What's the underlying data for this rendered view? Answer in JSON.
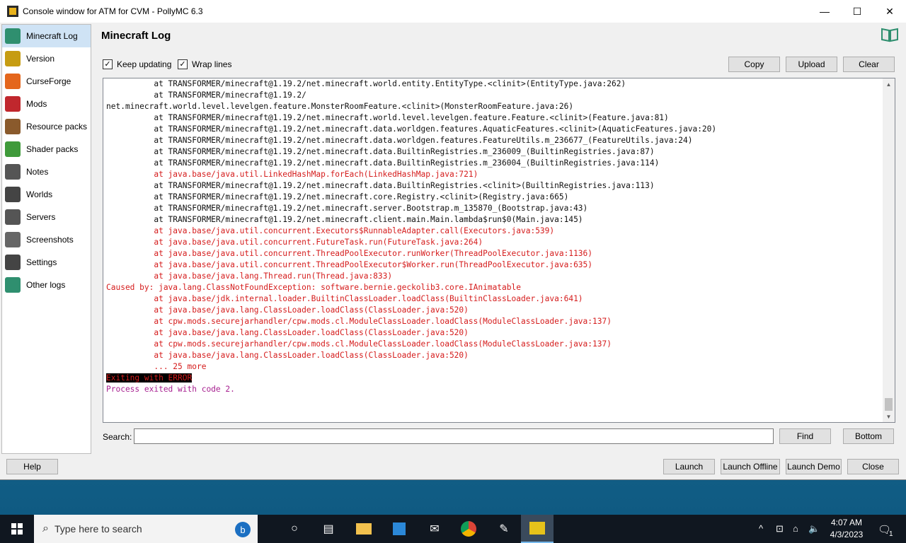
{
  "window": {
    "title": "Console window for ATM for CVM - PollyMC 6.3",
    "minimize": "—",
    "maximize": "☐",
    "close": "✕"
  },
  "sidebar": {
    "items": [
      {
        "label": "Minecraft Log",
        "icon": "book-icon",
        "color": "#2f8f6f",
        "active": true
      },
      {
        "label": "Version",
        "icon": "version-icon",
        "color": "#c69c12"
      },
      {
        "label": "CurseForge",
        "icon": "curseforge-icon",
        "color": "#e4661c"
      },
      {
        "label": "Mods",
        "icon": "mods-icon",
        "color": "#c0272d"
      },
      {
        "label": "Resource packs",
        "icon": "resource-pack-icon",
        "color": "#8a5a2c"
      },
      {
        "label": "Shader packs",
        "icon": "shader-pack-icon",
        "color": "#3f9a3a"
      },
      {
        "label": "Notes",
        "icon": "notes-icon",
        "color": "#555555"
      },
      {
        "label": "Worlds",
        "icon": "worlds-icon",
        "color": "#444444"
      },
      {
        "label": "Servers",
        "icon": "servers-icon",
        "color": "#555555"
      },
      {
        "label": "Screenshots",
        "icon": "screenshots-icon",
        "color": "#666666"
      },
      {
        "label": "Settings",
        "icon": "settings-icon",
        "color": "#444444"
      },
      {
        "label": "Other logs",
        "icon": "other-logs-icon",
        "color": "#2f8f6f"
      }
    ]
  },
  "main": {
    "title": "Minecraft Log",
    "keep_updating": "Keep updating",
    "wrap_lines": "Wrap lines",
    "copy": "Copy",
    "upload": "Upload",
    "clear": "Clear",
    "search_label": "Search:",
    "search_value": "",
    "find": "Find",
    "bottom": "Bottom"
  },
  "log": {
    "lines": [
      {
        "text": "          at TRANSFORMER/minecraft@1.19.2/net.minecraft.world.entity.EntityType.<clinit>(EntityType.java:262)",
        "kind": "normal"
      },
      {
        "text": "          at TRANSFORMER/minecraft@1.19.2/",
        "kind": "normal"
      },
      {
        "text": "net.minecraft.world.level.levelgen.feature.MonsterRoomFeature.<clinit>(MonsterRoomFeature.java:26)",
        "kind": "normal"
      },
      {
        "text": "          at TRANSFORMER/minecraft@1.19.2/net.minecraft.world.level.levelgen.feature.Feature.<clinit>(Feature.java:81)",
        "kind": "normal"
      },
      {
        "text": "          at TRANSFORMER/minecraft@1.19.2/net.minecraft.data.worldgen.features.AquaticFeatures.<clinit>(AquaticFeatures.java:20)",
        "kind": "normal"
      },
      {
        "text": "          at TRANSFORMER/minecraft@1.19.2/net.minecraft.data.worldgen.features.FeatureUtils.m_236677_(FeatureUtils.java:24)",
        "kind": "normal"
      },
      {
        "text": "          at TRANSFORMER/minecraft@1.19.2/net.minecraft.data.BuiltinRegistries.m_236009_(BuiltinRegistries.java:87)",
        "kind": "normal"
      },
      {
        "text": "          at TRANSFORMER/minecraft@1.19.2/net.minecraft.data.BuiltinRegistries.m_236004_(BuiltinRegistries.java:114)",
        "kind": "normal"
      },
      {
        "text": "          at java.base/java.util.LinkedHashMap.forEach(LinkedHashMap.java:721)",
        "kind": "err"
      },
      {
        "text": "          at TRANSFORMER/minecraft@1.19.2/net.minecraft.data.BuiltinRegistries.<clinit>(BuiltinRegistries.java:113)",
        "kind": "normal"
      },
      {
        "text": "          at TRANSFORMER/minecraft@1.19.2/net.minecraft.core.Registry.<clinit>(Registry.java:665)",
        "kind": "normal"
      },
      {
        "text": "          at TRANSFORMER/minecraft@1.19.2/net.minecraft.server.Bootstrap.m_135870_(Bootstrap.java:43)",
        "kind": "normal"
      },
      {
        "text": "          at TRANSFORMER/minecraft@1.19.2/net.minecraft.client.main.Main.lambda$run$0(Main.java:145)",
        "kind": "normal"
      },
      {
        "text": "          at java.base/java.util.concurrent.Executors$RunnableAdapter.call(Executors.java:539)",
        "kind": "err"
      },
      {
        "text": "          at java.base/java.util.concurrent.FutureTask.run(FutureTask.java:264)",
        "kind": "err"
      },
      {
        "text": "          at java.base/java.util.concurrent.ThreadPoolExecutor.runWorker(ThreadPoolExecutor.java:1136)",
        "kind": "err"
      },
      {
        "text": "          at java.base/java.util.concurrent.ThreadPoolExecutor$Worker.run(ThreadPoolExecutor.java:635)",
        "kind": "err"
      },
      {
        "text": "          at java.base/java.lang.Thread.run(Thread.java:833)",
        "kind": "err"
      },
      {
        "text": "Caused by: java.lang.ClassNotFoundException: software.bernie.geckolib3.core.IAnimatable",
        "kind": "err"
      },
      {
        "text": "          at java.base/jdk.internal.loader.BuiltinClassLoader.loadClass(BuiltinClassLoader.java:641)",
        "kind": "err"
      },
      {
        "text": "          at java.base/java.lang.ClassLoader.loadClass(ClassLoader.java:520)",
        "kind": "err"
      },
      {
        "text": "          at cpw.mods.securejarhandler/cpw.mods.cl.ModuleClassLoader.loadClass(ModuleClassLoader.java:137)",
        "kind": "err"
      },
      {
        "text": "          at java.base/java.lang.ClassLoader.loadClass(ClassLoader.java:520)",
        "kind": "err"
      },
      {
        "text": "          at cpw.mods.securejarhandler/cpw.mods.cl.ModuleClassLoader.loadClass(ModuleClassLoader.java:137)",
        "kind": "err"
      },
      {
        "text": "          at java.base/java.lang.ClassLoader.loadClass(ClassLoader.java:520)",
        "kind": "err"
      },
      {
        "text": "          ... 25 more",
        "kind": "err"
      },
      {
        "text": "Exiting with ERROR",
        "kind": "errbox"
      },
      {
        "text": "Process exited with code 2.",
        "kind": "exit"
      }
    ]
  },
  "footer": {
    "help": "Help",
    "launch": "Launch",
    "launch_offline": "Launch Offline",
    "launch_demo": "Launch Demo",
    "close": "Close"
  },
  "taskbar": {
    "search_placeholder": "Type here to search",
    "time": "4:07 AM",
    "date": "4/3/2023",
    "notification_count": "1"
  }
}
